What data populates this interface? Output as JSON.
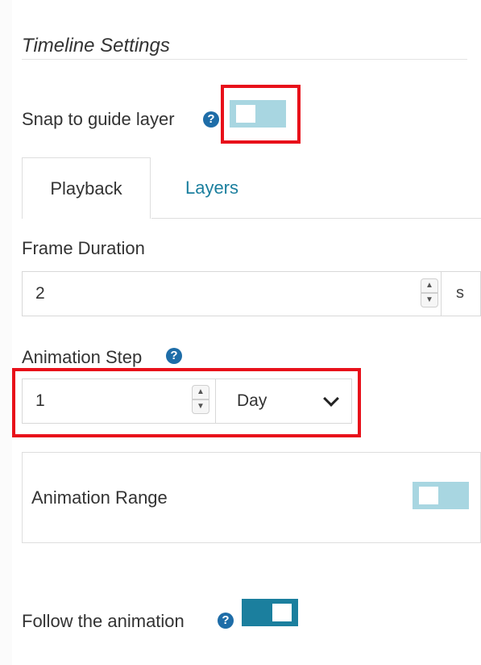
{
  "section": {
    "title": "Timeline Settings"
  },
  "snap_guide": {
    "label": "Snap to guide layer",
    "help_icon": "question-circle-icon",
    "enabled": false
  },
  "tabs": [
    {
      "label": "Playback",
      "active": true
    },
    {
      "label": "Layers",
      "active": false
    }
  ],
  "frame_duration": {
    "label": "Frame Duration",
    "value": "2",
    "unit": "s"
  },
  "animation_step": {
    "label": "Animation Step",
    "help_icon": "question-circle-icon",
    "value": "1",
    "unit_selected": "Day"
  },
  "animation_range": {
    "label": "Animation Range",
    "enabled": false
  },
  "follow_animation": {
    "label": "Follow the animation",
    "help_icon": "question-circle-icon",
    "enabled": true
  },
  "colors": {
    "accent": "#1b7f9e",
    "toggle_off": "#a8d6e1",
    "help_icon": "#1e6da8",
    "highlight": "#e8101a"
  }
}
